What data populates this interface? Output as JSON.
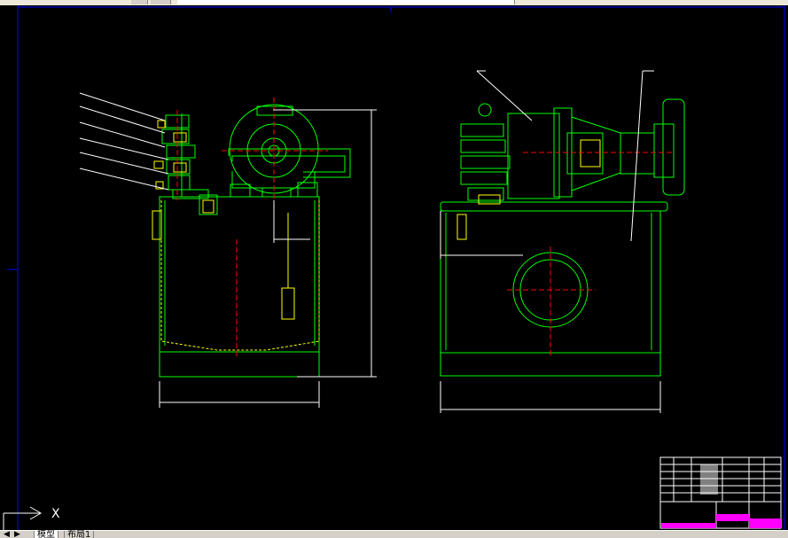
{
  "tabs": {
    "model_label": "模型",
    "layout_label": "布局1",
    "nav_prev": "◀",
    "nav_next": "▶"
  },
  "ucs": {
    "axis_label": "X"
  },
  "colors": {
    "background": "#000000",
    "outline": "#00ff00",
    "detail": "#ffff00",
    "centerline": "#ff0000",
    "dimension": "#ffffff",
    "frame": "#0000ff",
    "title_fill": "#ff00ff"
  }
}
